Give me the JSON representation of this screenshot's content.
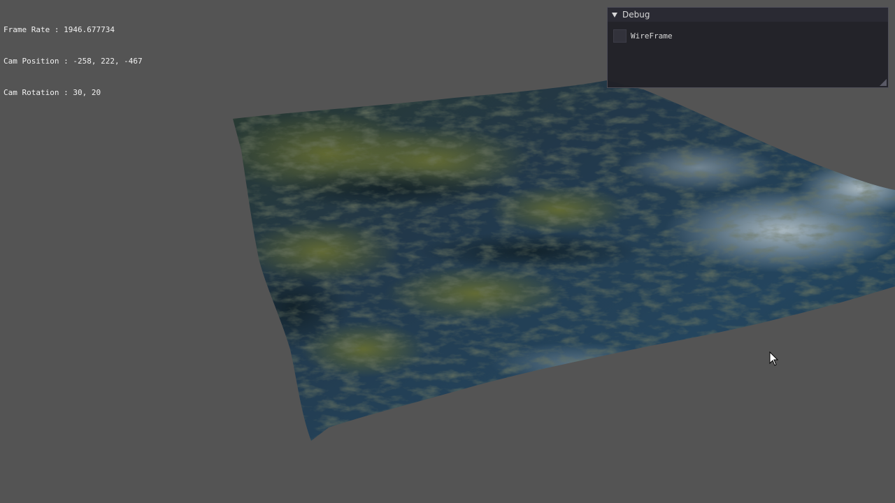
{
  "hud": {
    "frame_rate_label": "Frame Rate : 1946.677734",
    "cam_position_label": "Cam Position : -258, 222, -467",
    "cam_rotation_label": "Cam Rotation : 30, 20"
  },
  "debug_window": {
    "title": "Debug",
    "wireframe_label": "WireFrame",
    "wireframe_checked": false
  },
  "colors": {
    "background": "#545454",
    "terrain_dark": "#1c3340",
    "terrain_moss": "#4f5a26",
    "terrain_water": "#2d4f66",
    "terrain_highlight": "#b9c8cf"
  }
}
